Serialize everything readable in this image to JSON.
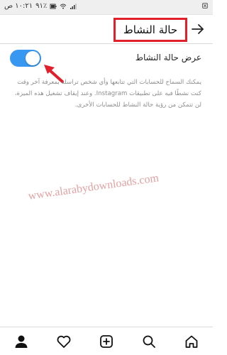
{
  "status_bar": {
    "time": "١٠:٢١ ص",
    "battery": "٩١٪",
    "icons": [
      "wifi-icon",
      "signal-icon",
      "battery-icon",
      "notification-icon"
    ]
  },
  "header": {
    "title": "حالة النشاط",
    "back_icon": "arrow-right-icon",
    "highlight_color": "#e0202a"
  },
  "setting": {
    "label": "عرض حالة النشاط",
    "toggle_on": true,
    "toggle_color": "#3897f0"
  },
  "description": "يمكنك السماح للحسابات التي تتابعها وأي شخص تراسله بمعرفة آخر وقت كنت نشطًا فيه على تطبيقات Instagram. وعند إيقاف تشغيل هذه الميزة، لن تتمكن من رؤية حالة النشاط للحسابات الأخرى.",
  "watermark": "www.alarabydownloads.com",
  "bottom_nav": {
    "items": [
      "profile-icon",
      "heart-icon",
      "add-post-icon",
      "search-icon",
      "home-icon"
    ]
  },
  "annotation": {
    "arrow_color": "#e0202a"
  }
}
